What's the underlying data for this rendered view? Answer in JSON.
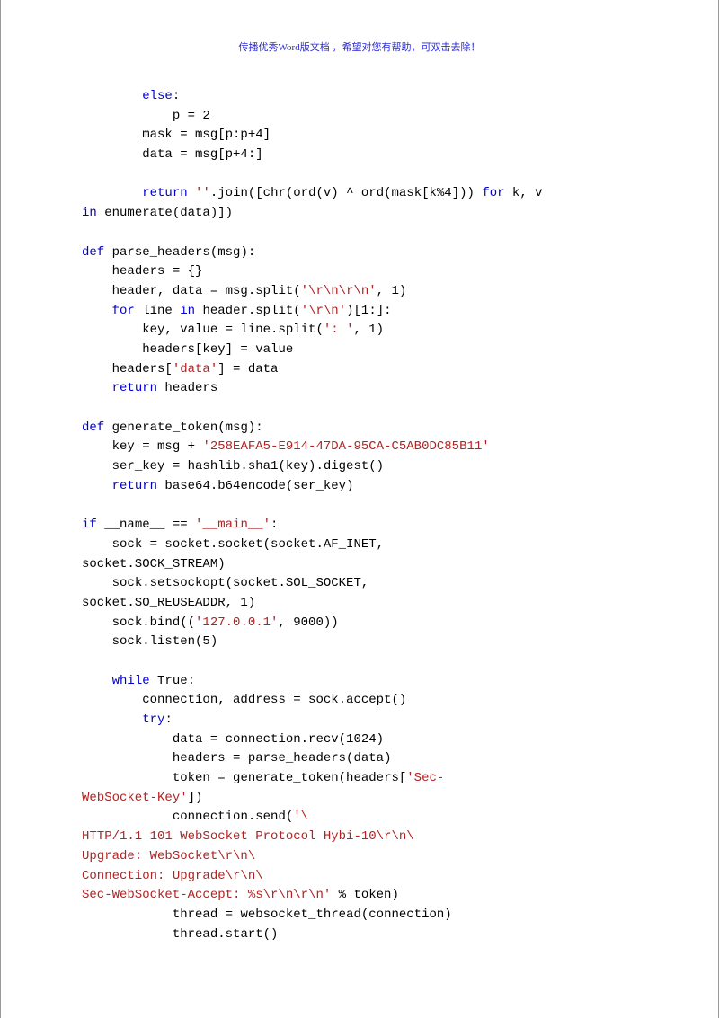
{
  "header_note": "传播优秀Word版文档 ，希望对您有帮助，可双击去除！",
  "code": {
    "l01": {
      "ind": "        ",
      "kw": "else",
      "rest": ":"
    },
    "l02": {
      "ind": "            ",
      "txt": "p = 2"
    },
    "l03": {
      "ind": "        ",
      "txt": "mask = msg[p:p+4]"
    },
    "l04": {
      "ind": "        ",
      "txt": "data = msg[p+4:]"
    },
    "l05": "",
    "l06": {
      "ind": "        ",
      "kw1": "return",
      "mid": " ",
      "str1": "''",
      "mid2": ".join([chr(ord(v) ^ ord(mask[k%4])) ",
      "kw2": "for",
      "mid3": " k, v "
    },
    "l07": {
      "kw": "in",
      "rest": " enumerate(data)])"
    },
    "l08": "",
    "l09": {
      "kw": "def",
      "rest": " parse_headers(msg):"
    },
    "l10": {
      "ind": "    ",
      "txt": "headers = {}"
    },
    "l11": {
      "ind": "    ",
      "pre": "header, data = msg.split(",
      "str": "'\\r\\n\\r\\n'",
      "post": ", 1)"
    },
    "l12": {
      "ind": "    ",
      "kw1": "for",
      "mid1": " line ",
      "kw2": "in",
      "mid2": " header.split(",
      "str": "'\\r\\n'",
      "post": ")[1:]:"
    },
    "l13": {
      "ind": "        ",
      "pre": "key, value = line.split(",
      "str": "': '",
      "post": ", 1)"
    },
    "l14": {
      "ind": "        ",
      "txt": "headers[key] = value"
    },
    "l15": {
      "ind": "    ",
      "pre": "headers[",
      "str": "'data'",
      "post": "] = data"
    },
    "l16": {
      "ind": "    ",
      "kw": "return",
      "rest": " headers"
    },
    "l17": "",
    "l18": {
      "kw": "def",
      "rest": " generate_token(msg):"
    },
    "l19": {
      "ind": "    ",
      "pre": "key = msg + ",
      "str": "'258EAFA5-E914-47DA-95CA-C5AB0DC85B11'"
    },
    "l20": {
      "ind": "    ",
      "txt": "ser_key = hashlib.sha1(key).digest()"
    },
    "l21": {
      "ind": "    ",
      "kw": "return",
      "rest": " base64.b64encode(ser_key)"
    },
    "l22": "",
    "l23": {
      "kw": "if",
      "mid": " __name__ == ",
      "str": "'__main__'",
      "post": ":"
    },
    "l24": {
      "ind": "    ",
      "txt": "sock = socket.socket(socket.AF_INET, "
    },
    "l25": {
      "txt": "socket.SOCK_STREAM)"
    },
    "l26": {
      "ind": "    ",
      "txt": "sock.setsockopt(socket.SOL_SOCKET, "
    },
    "l27": {
      "txt": "socket.SO_REUSEADDR, 1)"
    },
    "l28": {
      "ind": "    ",
      "pre": "sock.bind((",
      "str": "'127.0.0.1'",
      "post": ", 9000))"
    },
    "l29": {
      "ind": "    ",
      "txt": "sock.listen(5)"
    },
    "l30": "",
    "l31": {
      "ind": "    ",
      "kw": "while",
      "rest": " True:"
    },
    "l32": {
      "ind": "        ",
      "txt": "connection, address = sock.accept()"
    },
    "l33": {
      "ind": "        ",
      "kw": "try",
      "rest": ":"
    },
    "l34": {
      "ind": "            ",
      "txt": "data = connection.recv(1024)"
    },
    "l35": {
      "ind": "            ",
      "txt": "headers = parse_headers(data)"
    },
    "l36": {
      "ind": "            ",
      "pre": "token = generate_token(headers[",
      "str": "'Sec-"
    },
    "l37": {
      "str": "WebSocket-Key'",
      "post": "])"
    },
    "l38": {
      "ind": "            ",
      "pre": "connection.send(",
      "str": "'\\"
    },
    "l39": {
      "str": "HTTP/1.1 101 WebSocket Protocol Hybi-10\\r\\n\\"
    },
    "l40": {
      "str": "Upgrade: WebSocket\\r\\n\\"
    },
    "l41": {
      "str": "Connection: Upgrade\\r\\n\\"
    },
    "l42": {
      "str": "Sec-WebSocket-Accept: %s\\r\\n\\r\\n'",
      "post": " % token)"
    },
    "l43": {
      "ind": "            ",
      "txt": "thread = websocket_thread(connection)"
    },
    "l44": {
      "ind": "            ",
      "txt": "thread.start()"
    }
  }
}
